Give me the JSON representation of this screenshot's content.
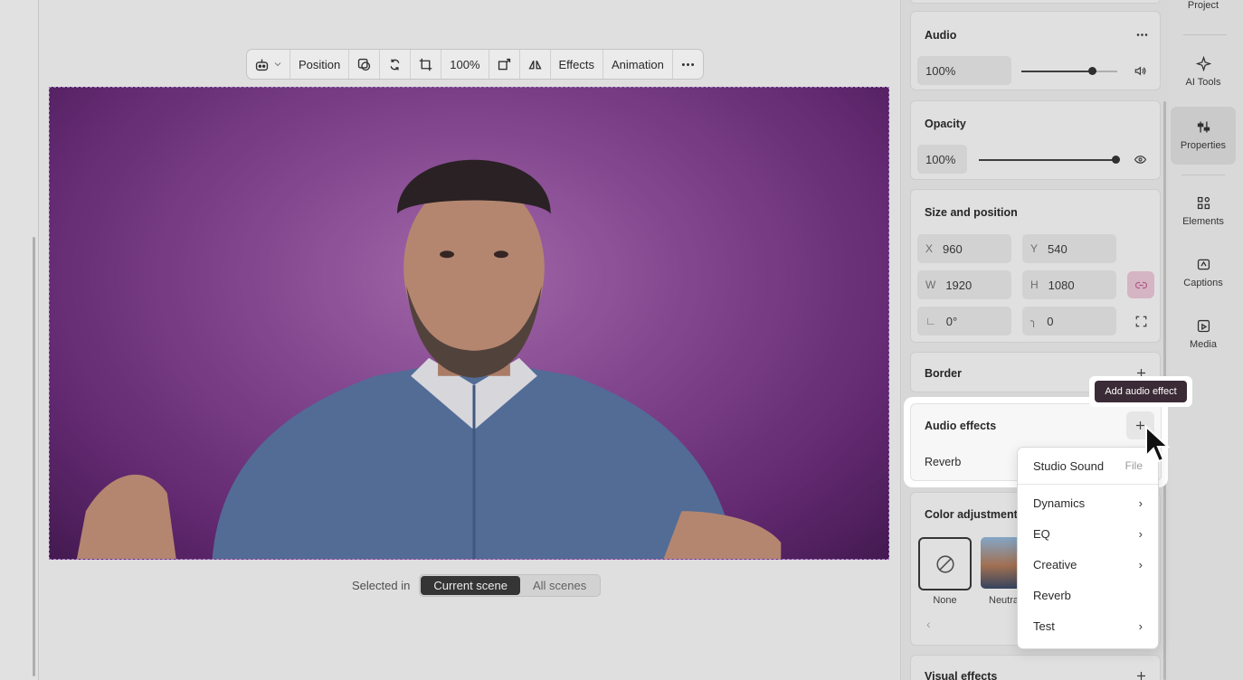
{
  "toolbar": {
    "position_label": "Position",
    "zoom_label": "100%",
    "effects_label": "Effects",
    "animation_label": "Animation",
    "icons": [
      "robot-icon",
      "chevron-down-icon",
      "shape-icon",
      "replace-icon",
      "crop-icon",
      "transform-icon",
      "flip-icon",
      "more-icon"
    ]
  },
  "selection": {
    "label": "Selected in",
    "options": [
      "Current scene",
      "All scenes"
    ],
    "active": "Current scene"
  },
  "panel": {
    "audio": {
      "title": "Audio",
      "volume": "100%",
      "volume_level": 0.78
    },
    "opacity": {
      "title": "Opacity",
      "value": "100%",
      "level": 1.0
    },
    "size_position": {
      "title": "Size and position",
      "x_label": "X",
      "x": "960",
      "y_label": "Y",
      "y": "540",
      "w_label": "W",
      "w": "1920",
      "h_label": "H",
      "h": "1080",
      "rotation": "0°",
      "radius": "0"
    },
    "border": {
      "title": "Border"
    },
    "audio_effects": {
      "title": "Audio effects",
      "item": "Reverb"
    },
    "color_adjustments": {
      "title": "Color adjustments",
      "presets": [
        "None",
        "Neutra"
      ]
    },
    "visual_effects": {
      "title": "Visual effects"
    }
  },
  "tooltip": {
    "text": "Add audio effect"
  },
  "menu": {
    "header": "Studio Sound",
    "header_tag": "File",
    "items": [
      {
        "label": "Dynamics",
        "submenu": true
      },
      {
        "label": "EQ",
        "submenu": true
      },
      {
        "label": "Creative",
        "submenu": true
      },
      {
        "label": "Reverb",
        "submenu": false
      },
      {
        "label": "Test",
        "submenu": true
      }
    ]
  },
  "rail": {
    "items": [
      "Project",
      "AI Tools",
      "Properties",
      "Elements",
      "Captions",
      "Media"
    ],
    "active": "Properties"
  },
  "colors": {
    "accent": "#3b2b36",
    "link_active": "#d98fb0"
  }
}
